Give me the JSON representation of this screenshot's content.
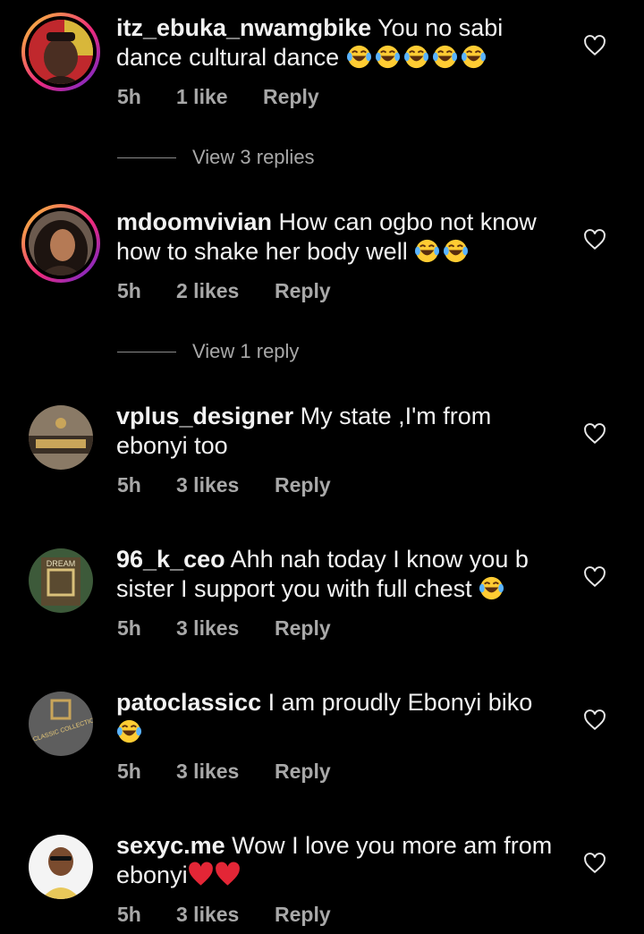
{
  "comments": [
    {
      "username": "itz_ebuka_nwamgbike",
      "text": " You no sabi dance cultural dance ",
      "emoji_count": 5,
      "time": "5h",
      "likes": "1 like",
      "reply_label": "Reply",
      "view_replies": "View 3 replies"
    },
    {
      "username": "mdoomvivian",
      "text": " How can ogbo not know how to shake her body well ",
      "emoji_count": 2,
      "time": "5h",
      "likes": "2 likes",
      "reply_label": "Reply",
      "view_replies": "View 1 reply"
    },
    {
      "username": "vplus_designer",
      "text": " My state ,I'm from ebonyi too",
      "time": "5h",
      "likes": "3 likes",
      "reply_label": "Reply"
    },
    {
      "username": "96_k_ceo",
      "text": " Ahh nah today I know you b sister I support you with full chest ",
      "emoji_count": 1,
      "time": "5h",
      "likes": "3 likes",
      "reply_label": "Reply"
    },
    {
      "username": "patoclassicc",
      "text": " I am proudly Ebonyi biko ",
      "emoji_count": 1,
      "time": "5h",
      "likes": "3 likes",
      "reply_label": "Reply"
    },
    {
      "username": "sexyc.me",
      "text": " Wow I love you more am from ebonyi",
      "heart_emoji_count": 2,
      "time": "5h",
      "likes": "3 likes",
      "reply_label": "Reply"
    }
  ],
  "avatar_logos": {
    "dream": "DREAM",
    "pato": "PATOCLASSIC COLLECTIONS"
  },
  "colors": {
    "background": "#000000",
    "text": "#f2f2f2",
    "meta": "#a8a8a8"
  }
}
